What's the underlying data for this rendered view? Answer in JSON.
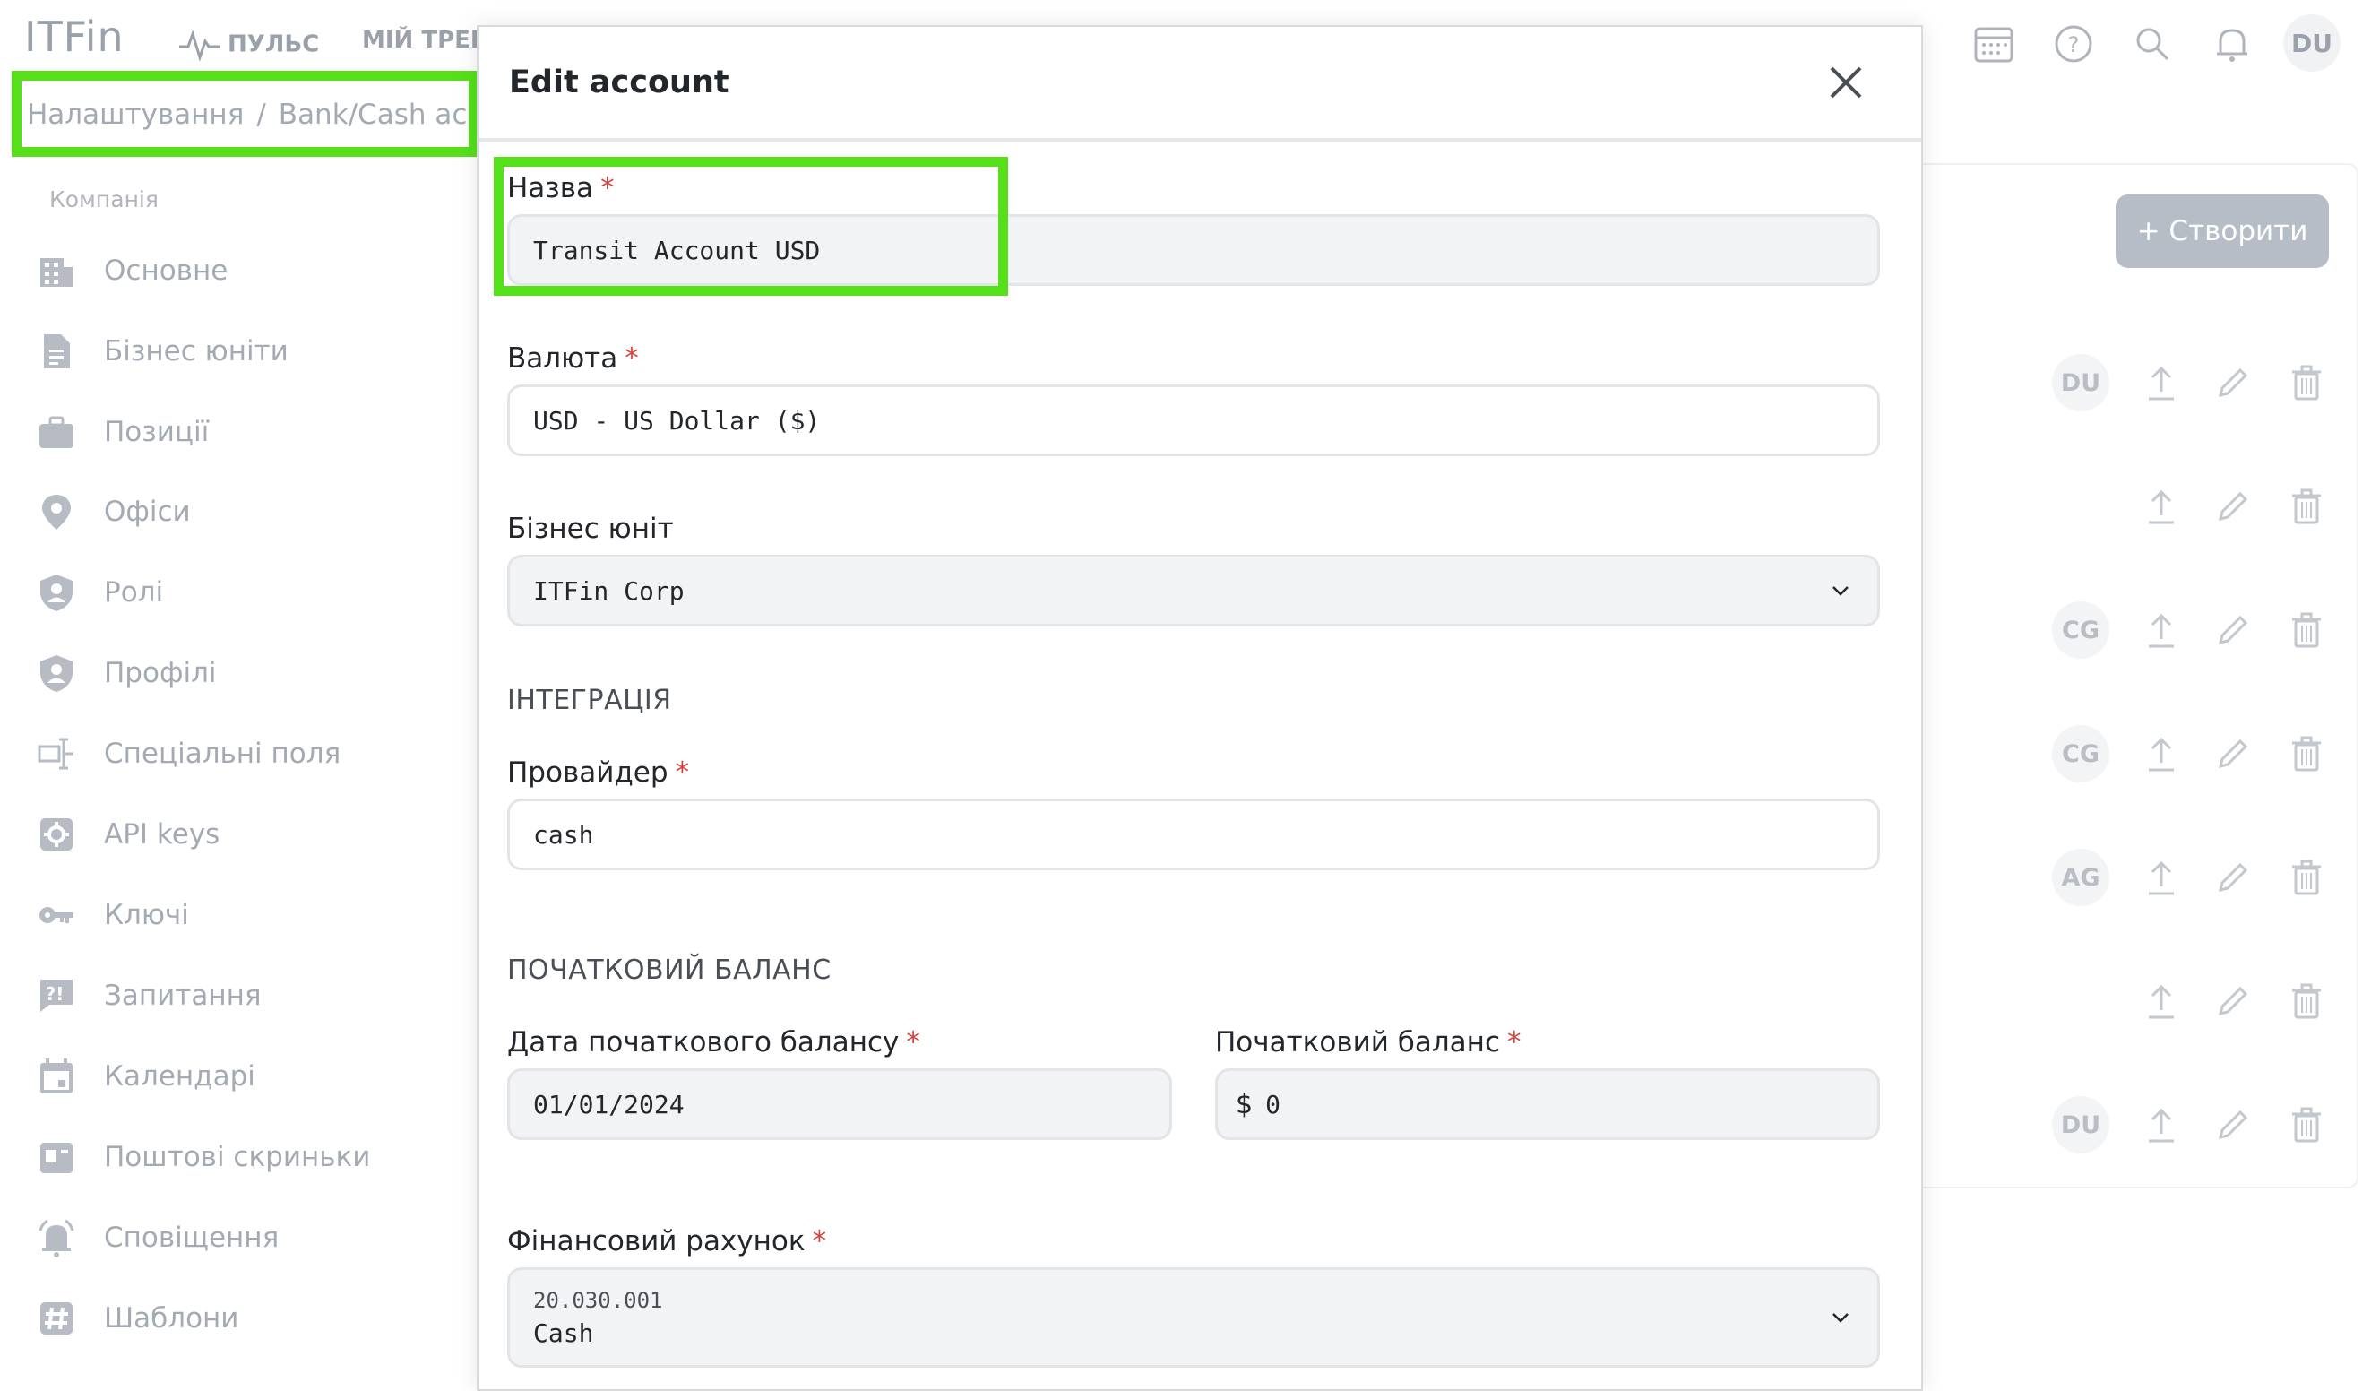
{
  "app": {
    "logo": "ITFin"
  },
  "topnav": {
    "pulse": "ПУЛЬС",
    "tracker": "МІЙ ТРЕКЕ"
  },
  "header": {
    "avatar": "DU"
  },
  "breadcrumb": {
    "settings": "Налаштування",
    "separator": "/",
    "current": "Bank/Cash accounts"
  },
  "sidebar": {
    "section": "Компанія",
    "items": [
      {
        "label": "Основне",
        "icon": "building-icon"
      },
      {
        "label": "Бізнес юніти",
        "icon": "document-icon"
      },
      {
        "label": "Позиції",
        "icon": "briefcase-icon"
      },
      {
        "label": "Офіси",
        "icon": "location-pin-icon"
      },
      {
        "label": "Ролі",
        "icon": "shield-user-icon"
      },
      {
        "label": "Профілі",
        "icon": "shield-user-icon"
      },
      {
        "label": "Спеціальні поля",
        "icon": "custom-fields-icon"
      },
      {
        "label": "API keys",
        "icon": "gear-icon"
      },
      {
        "label": "Ключі",
        "icon": "key-icon"
      },
      {
        "label": "Запитання",
        "icon": "question-chat-icon"
      },
      {
        "label": "Календарі",
        "icon": "calendar-icon"
      },
      {
        "label": "Поштові скриньки",
        "icon": "mailbox-icon"
      },
      {
        "label": "Сповіщення",
        "icon": "bell-ring-icon"
      },
      {
        "label": "Шаблони",
        "icon": "hash-icon"
      }
    ]
  },
  "background": {
    "create_button": "+ Створити",
    "rows": [
      {
        "avatar": "DU"
      },
      {
        "avatar": ""
      },
      {
        "avatar": "CG"
      },
      {
        "avatar": "CG"
      },
      {
        "avatar": "AG"
      },
      {
        "avatar": ""
      },
      {
        "avatar": "DU"
      }
    ]
  },
  "modal": {
    "title": "Edit account",
    "name_label": "Назва",
    "name_value": "Transit Account USD",
    "currency_label": "Валюта",
    "currency_value": "USD - US Dollar ($)",
    "business_unit_label": "Бізнес юніт",
    "business_unit_value": "ITFin Corp",
    "integration_heading": "ІНТЕГРАЦІЯ",
    "provider_label": "Провайдер",
    "provider_value": "cash",
    "opening_balance_heading": "ПОЧАТКОВИЙ БАЛАНС",
    "opening_date_label": "Дата початкового балансу",
    "opening_date_value": "01/01/2024",
    "opening_balance_label": "Початковий баланс",
    "opening_balance_currency": "$",
    "opening_balance_value": "0",
    "financial_account_label": "Фінансовий рахунок",
    "financial_account_code": "20.030.001",
    "financial_account_name": "Cash",
    "required_mark": "*"
  },
  "colors": {
    "highlight": "#55e01a",
    "required": "#d0453f",
    "muted": "#a4aab3"
  }
}
